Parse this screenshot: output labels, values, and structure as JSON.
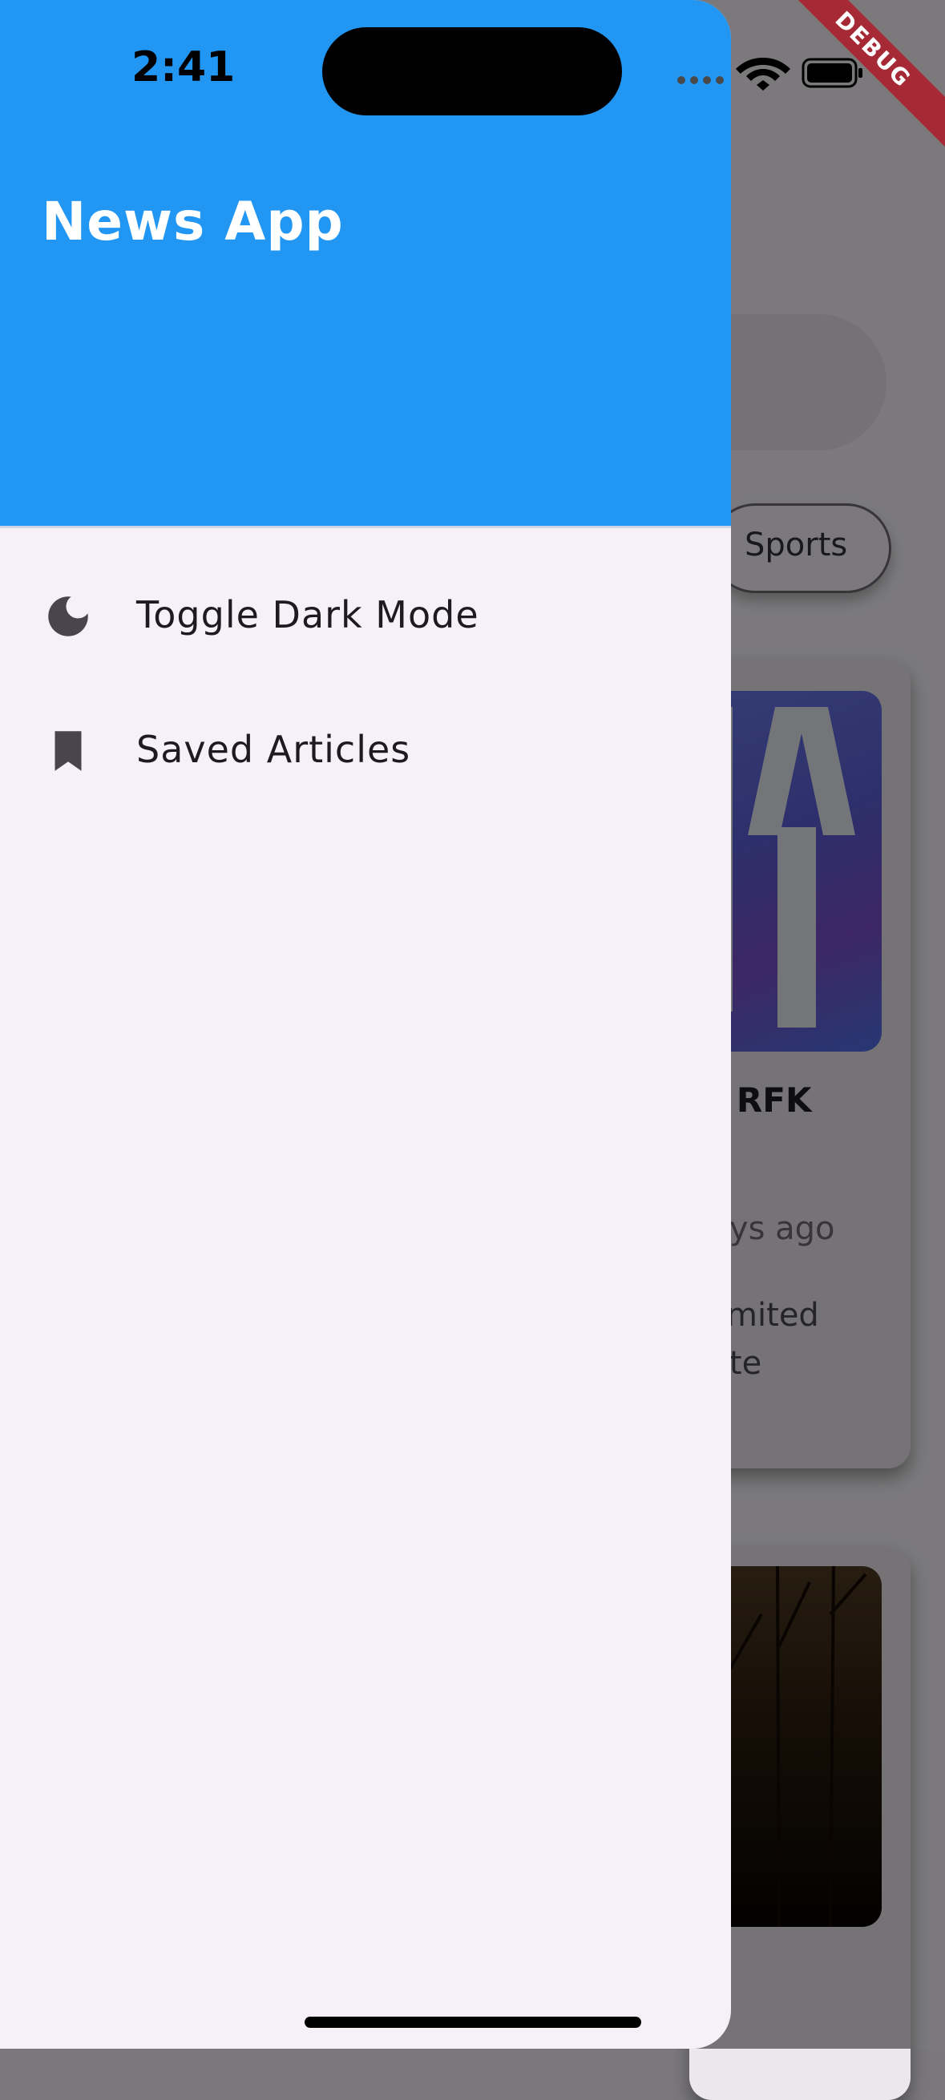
{
  "status_bar": {
    "time": "2:41",
    "icons": [
      "signal-dots-icon",
      "wifi-icon",
      "battery-icon"
    ]
  },
  "debug_banner": "DEBUG",
  "background_screen": {
    "category_chip_visible": "Sports",
    "card1": {
      "title_fragment": "in RFK",
      "time_fragment": "days ago",
      "desc_line1": "l limited",
      "desc_line2": "date"
    }
  },
  "drawer": {
    "header_title": "News App",
    "header_color": "#2196f3",
    "items": [
      {
        "label": "Toggle Dark Mode",
        "icon": "moon-icon"
      },
      {
        "label": "Saved Articles",
        "icon": "bookmark-icon"
      }
    ]
  }
}
